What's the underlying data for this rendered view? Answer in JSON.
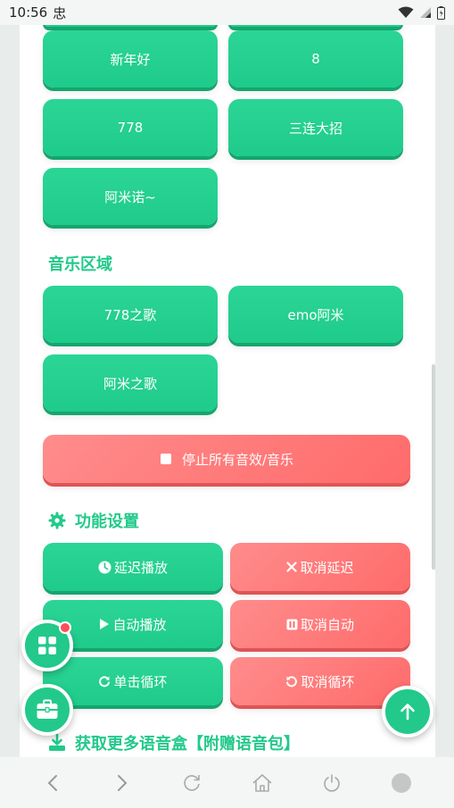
{
  "status_bar": {
    "time": "10:56",
    "carrier_glyph": "忠"
  },
  "voice_buttons": [
    {
      "label": "新年好"
    },
    {
      "label": "8"
    },
    {
      "label": "778"
    },
    {
      "label": "三连大招"
    },
    {
      "label": "阿米诺~"
    }
  ],
  "music_section": {
    "title": "音乐区域",
    "buttons": [
      {
        "label": "778之歌"
      },
      {
        "label": "emo阿米"
      },
      {
        "label": "阿米之歌"
      }
    ]
  },
  "stop_all": {
    "label": "停止所有音效/音乐"
  },
  "settings_section": {
    "title": "功能设置",
    "buttons": {
      "delay_play": "延迟播放",
      "cancel_delay": "取消延迟",
      "auto_play": "自动播放",
      "cancel_auto": "取消自动",
      "single_loop": "单击循环",
      "cancel_loop": "取消循环"
    }
  },
  "more_section": {
    "title": "获取更多语音盒【附赠语音包】"
  },
  "colors": {
    "primary_green": "#22c98b",
    "accent_red": "#ff6b6b",
    "badge_red": "#ff4d5a"
  }
}
